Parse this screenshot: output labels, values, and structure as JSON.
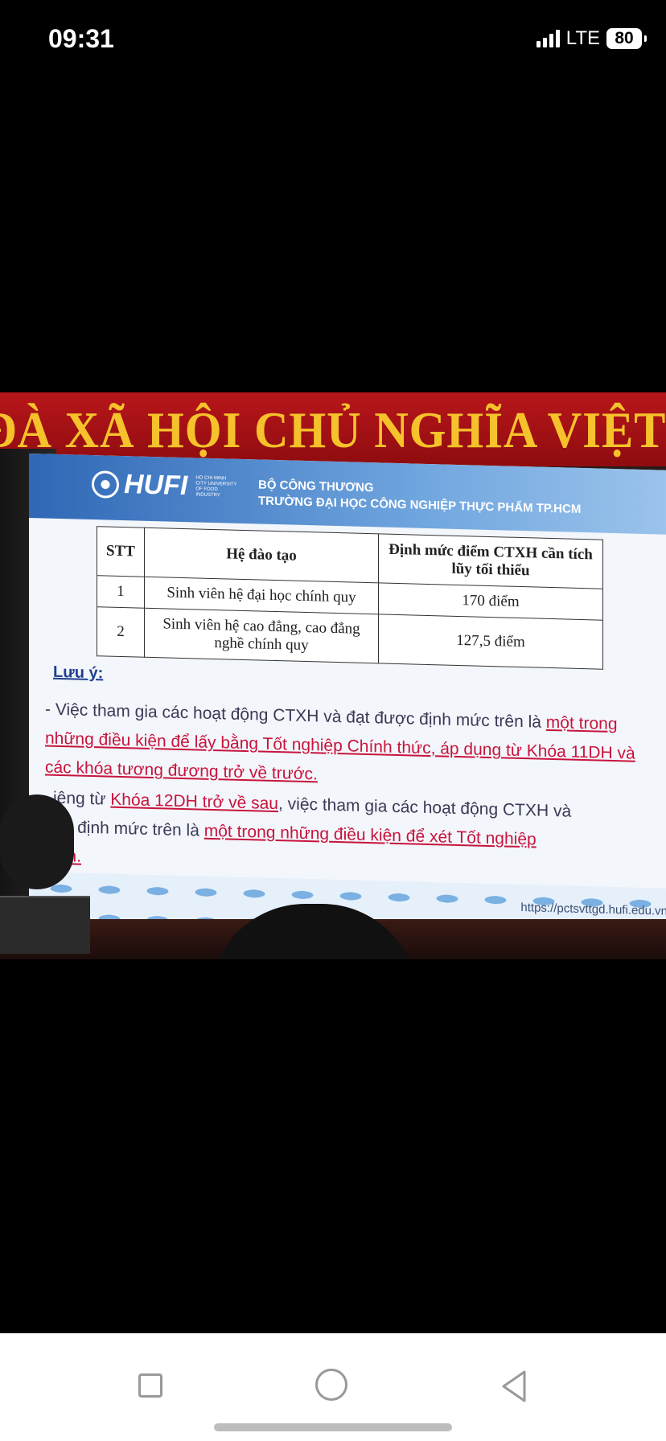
{
  "status_bar": {
    "time": "09:31",
    "network": "LTE",
    "battery": "80",
    "signal_icon": "signal-bars-icon",
    "battery_icon": "battery-icon"
  },
  "photo": {
    "banner_text": "ĐÀ XÃ HỘI CHỦ NGHĨA VIỆT",
    "slide": {
      "logo": "HUFI",
      "logo_sub": "HO CHI MINH CITY UNIVERSITY OF FOOD INDUSTRY",
      "ministry": "BỘ CÔNG THƯƠNG",
      "school": "TRƯỜNG ĐẠI HỌC CÔNG NGHIỆP THỰC PHẨM TP.HCM",
      "table": {
        "headers": [
          "STT",
          "Hệ đào tạo",
          "Định mức điểm CTXH cần tích lũy tối thiểu"
        ],
        "rows": [
          [
            "1",
            "Sinh viên hệ đại học chính quy",
            "170 điểm"
          ],
          [
            "2",
            "Sinh viên hệ cao đẳng, cao đẳng nghề chính quy",
            "127,5 điểm"
          ]
        ]
      },
      "note_title": "Lưu ý:",
      "para1_plain": "- Việc tham gia các hoạt động CTXH và đạt được định mức trên là ",
      "para1_highlight": "một trong những điều kiện để lấy bằng Tốt nghiệp Chính thức, áp dụng từ Khóa 11DH và các khóa tương đương trở về trước.",
      "para2_prefix": "iêng từ ",
      "para2_highlight1": "Khóa 12DH trở về sau",
      "para2_mid": ", việc tham gia các hoạt động CTXH và ",
      "para2_mid2": "ợc định mức trên là ",
      "para2_highlight2": "một trong những điều kiện để xét Tốt nghiệp",
      "para2_end": "ấm.",
      "url": "https://pctsvttgd.hufi.edu.vn"
    }
  },
  "nav_bar": {
    "recents_icon": "square-recents-icon",
    "home_icon": "circle-home-icon",
    "back_icon": "triangle-back-icon"
  }
}
